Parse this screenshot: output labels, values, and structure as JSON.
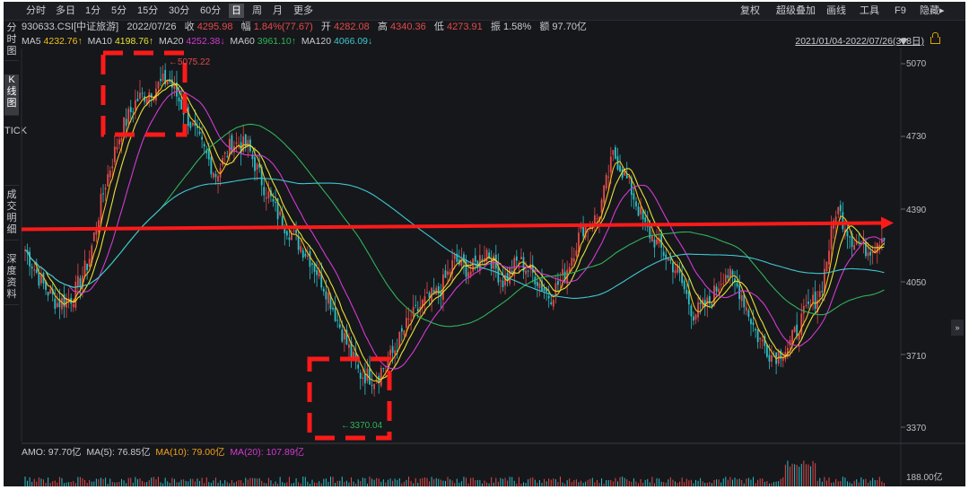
{
  "toolbar": {
    "periods": [
      "分时",
      "多日",
      "1分",
      "5分",
      "15分",
      "30分",
      "60分",
      "日",
      "周",
      "月",
      "更多"
    ],
    "active_period": "日",
    "right_items": [
      "复权",
      "超级叠加",
      "画线",
      "工具",
      "F9",
      "隐藏▸"
    ]
  },
  "side_tabs": [
    "分时图",
    "K线图",
    "TICK",
    "成交明细",
    "深度资料"
  ],
  "info": {
    "code": "930633.CSI[中证旅游]",
    "date": "2022/07/26",
    "close_label": "收",
    "close": "4295.98",
    "change_label": "幅",
    "change": "1.84%(77.67)",
    "open_label": "开",
    "open": "4282.08",
    "high_label": "高",
    "high": "4340.36",
    "low_label": "低",
    "low": "4273.91",
    "amp_label": "振",
    "amp": "1.58%",
    "amount_label": "额",
    "amount": "97.70亿"
  },
  "ma": [
    {
      "label": "MA5",
      "value": "4232.76↑",
      "color": "#f2c01b"
    },
    {
      "label": "MA10",
      "value": "4198.76↑",
      "color": "#e7e33a"
    },
    {
      "label": "MA20",
      "value": "4252.38↓",
      "color": "#d23ad2"
    },
    {
      "label": "MA60",
      "value": "3961.10↑",
      "color": "#2fb35a"
    },
    {
      "label": "MA120",
      "value": "4066.09↓",
      "color": "#3fc6d0"
    }
  ],
  "date_range": "2021/01/04-2022/07/26(378日)",
  "price_ticks": [
    "5070",
    "4730",
    "4390",
    "4050",
    "3710",
    "3370"
  ],
  "annotations": {
    "high": "5075.22",
    "low": "3370.04"
  },
  "amo": {
    "label": "AMO: 97.70亿",
    "ma5": "MA(5): 76.85亿",
    "ma10": "MA(10): 79.00亿",
    "ma20": "MA(20): 107.89亿",
    "tick": "188.00亿"
  },
  "chart_data": {
    "type": "candlestick",
    "ylim": [
      3370,
      5070
    ],
    "close_path": [
      4200,
      4050,
      3950,
      3980,
      4150,
      4500,
      4750,
      4900,
      4950,
      5000,
      4850,
      4700,
      4550,
      4700,
      4680,
      4500,
      4350,
      4250,
      4150,
      4000,
      3800,
      3620,
      3600,
      3700,
      3850,
      3950,
      4000,
      4150,
      4100,
      4200,
      4050,
      4150,
      4080,
      3980,
      4100,
      4300,
      4350,
      4650,
      4500,
      4300,
      4200,
      4100,
      3900,
      3950,
      4100,
      4000,
      3800,
      3700,
      3750,
      3900,
      4000,
      4400,
      4250,
      4200,
      4280
    ],
    "horizontal_line_value": 4325
  }
}
